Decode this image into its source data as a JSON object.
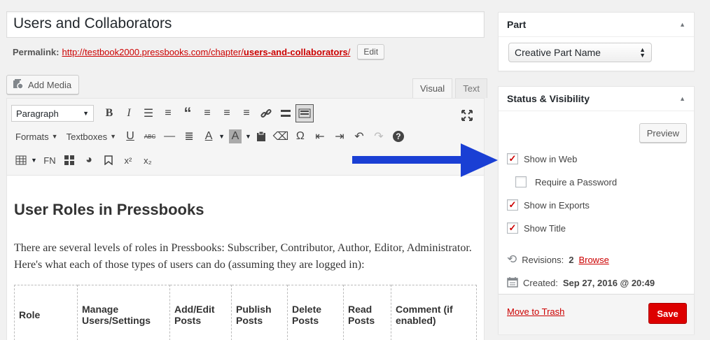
{
  "title": {
    "value": "Users and Collaborators"
  },
  "permalink": {
    "label": "Permalink:",
    "base": "http://testbook2000.pressbooks.com/chapter/",
    "slug": "users-and-collaborators",
    "trail": "/",
    "edit_label": "Edit"
  },
  "media": {
    "add_label": "Add Media"
  },
  "editor_tabs": {
    "visual": "Visual",
    "text": "Text"
  },
  "toolbar": {
    "paragraph_select": "Paragraph",
    "formats": "Formats",
    "textboxes": "Textboxes",
    "fn": "FN",
    "bold": "B",
    "italic": "I",
    "strike": "ABC",
    "omega": "Ω",
    "text_color": "A",
    "bg_color": "A",
    "superscript": "x²",
    "subscript": "x₂",
    "help": "?"
  },
  "content": {
    "heading": "User Roles in Pressbooks",
    "paragraph": "There are several levels of roles in Pressbooks: Subscriber, Contributor, Author, Editor, Administrator. Here's what each of those types of users can do (assuming they are logged in):",
    "table_headers": [
      "Role",
      "Manage Users/Settings",
      "Add/Edit Posts",
      "Publish Posts",
      "Delete Posts",
      "Read Posts",
      "Comment (if enabled)"
    ]
  },
  "part_box": {
    "title": "Part",
    "selected": "Creative Part Name"
  },
  "status_box": {
    "title": "Status & Visibility",
    "preview_label": "Preview",
    "show_in_web": "Show in Web",
    "require_password": "Require a Password",
    "show_in_exports": "Show in Exports",
    "show_title": "Show Title",
    "revisions_label": "Revisions:",
    "revisions_count": "2",
    "browse_label": "Browse",
    "created_label": "Created:",
    "created_value": "Sep 27, 2016 @ 20:49",
    "trash_label": "Move to Trash",
    "save_label": "Save"
  },
  "colors": {
    "accent": "#dd0000",
    "arrow": "#1a3fd4",
    "link": "#cc0000"
  }
}
